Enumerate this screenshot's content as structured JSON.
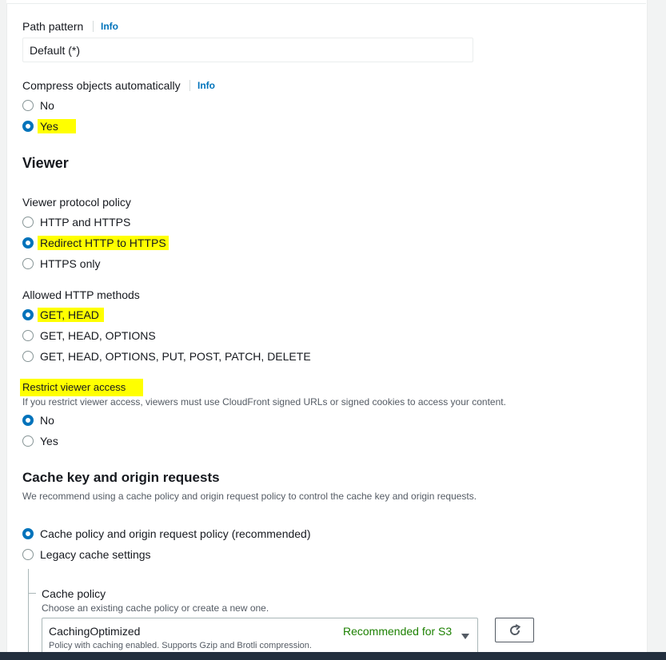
{
  "path_pattern": {
    "label": "Path pattern",
    "info": "Info",
    "value": "Default (*)"
  },
  "compress": {
    "label": "Compress objects automatically",
    "info": "Info",
    "options": [
      "No",
      "Yes"
    ],
    "selected": "Yes"
  },
  "viewer": {
    "heading": "Viewer",
    "protocol": {
      "label": "Viewer protocol policy",
      "options": [
        "HTTP and HTTPS",
        "Redirect HTTP to HTTPS",
        "HTTPS only"
      ],
      "selected": "Redirect HTTP to HTTPS"
    },
    "methods": {
      "label": "Allowed HTTP methods",
      "options": [
        "GET, HEAD",
        "GET, HEAD, OPTIONS",
        "GET, HEAD, OPTIONS, PUT, POST, PATCH, DELETE"
      ],
      "selected": "GET, HEAD"
    },
    "restrict": {
      "label": "Restrict viewer access",
      "description": "If you restrict viewer access, viewers must use CloudFront signed URLs or signed cookies to access your content.",
      "options": [
        "No",
        "Yes"
      ],
      "selected": "No"
    }
  },
  "cache": {
    "heading": "Cache key and origin requests",
    "description": "We recommend using a cache policy and origin request policy to control the cache key and origin requests.",
    "options": [
      "Cache policy and origin request policy (recommended)",
      "Legacy cache settings"
    ],
    "selected": "Cache policy and origin request policy (recommended)",
    "policy": {
      "label": "Cache policy",
      "description": "Choose an existing cache policy or create a new one.",
      "selected_name": "CachingOptimized",
      "selected_desc": "Policy with caching enabled. Supports Gzip and Brotli compression.",
      "badge": "Recommended for S3"
    }
  },
  "highlight_color": "#ffff00",
  "accent_color": "#0073bb",
  "icons": {
    "refresh": "refresh-icon",
    "dropdown": "caret-down-icon"
  }
}
